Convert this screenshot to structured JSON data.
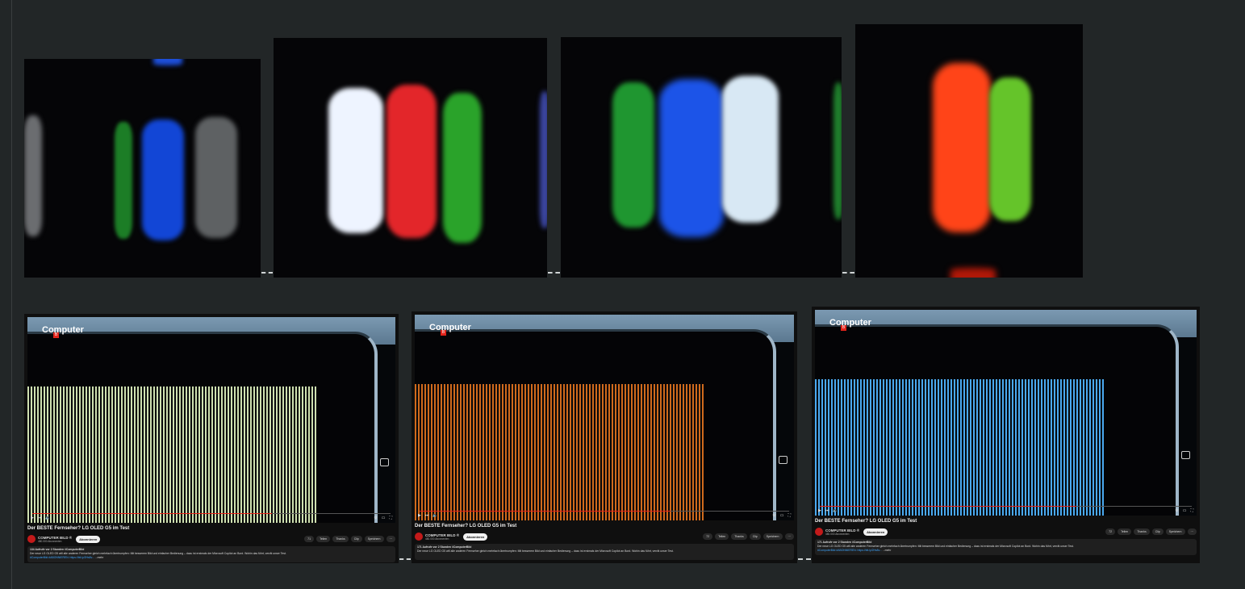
{
  "macros": [
    {
      "name": "macro-1",
      "colors": {
        "a": "#1f8a2a",
        "b": "#1246d6",
        "c": "#5e6163"
      }
    },
    {
      "name": "macro-2",
      "colors": {
        "a": "#eef4ff",
        "b": "#e3262a",
        "c": "#2aa32a"
      }
    },
    {
      "name": "macro-3",
      "colors": {
        "a": "#1f9630",
        "b": "#1c54e8",
        "c": "#d8e8f4"
      }
    },
    {
      "name": "macro-4",
      "colors": {
        "a": "#ff4418",
        "b": "#65c42a"
      }
    }
  ],
  "screens": [
    {
      "pixel_color": "#cfe0b0",
      "progress": 0.67,
      "logo": "Computer",
      "title": "Der BESTE Fernseher? LG OLED G5 im Test",
      "channel": "COMPUTER BILD ®",
      "subscribers": "480.000 Abonnenten",
      "subscribe": "Abonnieren",
      "actions": [
        "71",
        "Teilen",
        "Thanks",
        "Clip",
        "Speichern"
      ],
      "views": "134 Aufrufe  vor 2 Stunden  #ComputerBild",
      "desc": "Der neue LG OLED G5 will alle anderen Fernseher gleich mehrfach übertrumpfen: Mit besserem Bild und einfacher Bedienung – dazu ist erstmals der Microsoft Copilot an Bord. Wohin das führt, verrät unser Test.",
      "link": "#ComputerBild #ABONNIEREN: https://bit.ly/2Hs8v...",
      "more": "...mehr"
    },
    {
      "pixel_color": "#d06a1c",
      "progress": 0.68,
      "logo": "Computer",
      "title": "Der BESTE Fernseher? LG OLED G5 im Test",
      "channel": "COMPUTER BILD ®",
      "subscribers": "480.000 Abonnenten",
      "subscribe": "Abonnieren",
      "actions": [
        "72",
        "Teilen",
        "Thanks",
        "Clip",
        "Speichern"
      ],
      "views": "171 Aufrufe  vor 2 Stunden  #ComputerBild",
      "desc": "Der neue LG OLED G5 will alle anderen Fernseher gleich mehrfach übertrumpfen: Mit besserem Bild und einfacher Bedienung – dazu ist erstmals der Microsoft Copilot an Bord. Wohin das führt, verrät unser Test.",
      "link": "",
      "more": ""
    },
    {
      "pixel_color": "#4aa9f0",
      "progress": 0.69,
      "logo": "Computer",
      "title": "Der BESTE Fernseher? LG OLED G5 im Test",
      "channel": "COMPUTER BILD ®",
      "subscribers": "480.000 Abonnenten",
      "subscribe": "Abonnieren",
      "actions": [
        "72",
        "Teilen",
        "Thanks",
        "Clip",
        "Speichern"
      ],
      "views": "171 Aufrufe  vor 2 Stunden  #ComputerBild",
      "desc": "Der neue LG OLED G5 will alle anderen Fernseher gleich mehrfach übertrumpfen: Mit besserem Bild und einfacher Bedienung – dazu ist erstmals der Microsoft Copilot an Bord. Wohin das führt, verrät unser Test.",
      "link": "#ComputerBild #ABONNIEREN: https://bit.ly/2Hs8v...",
      "more": "...mehr"
    }
  ]
}
